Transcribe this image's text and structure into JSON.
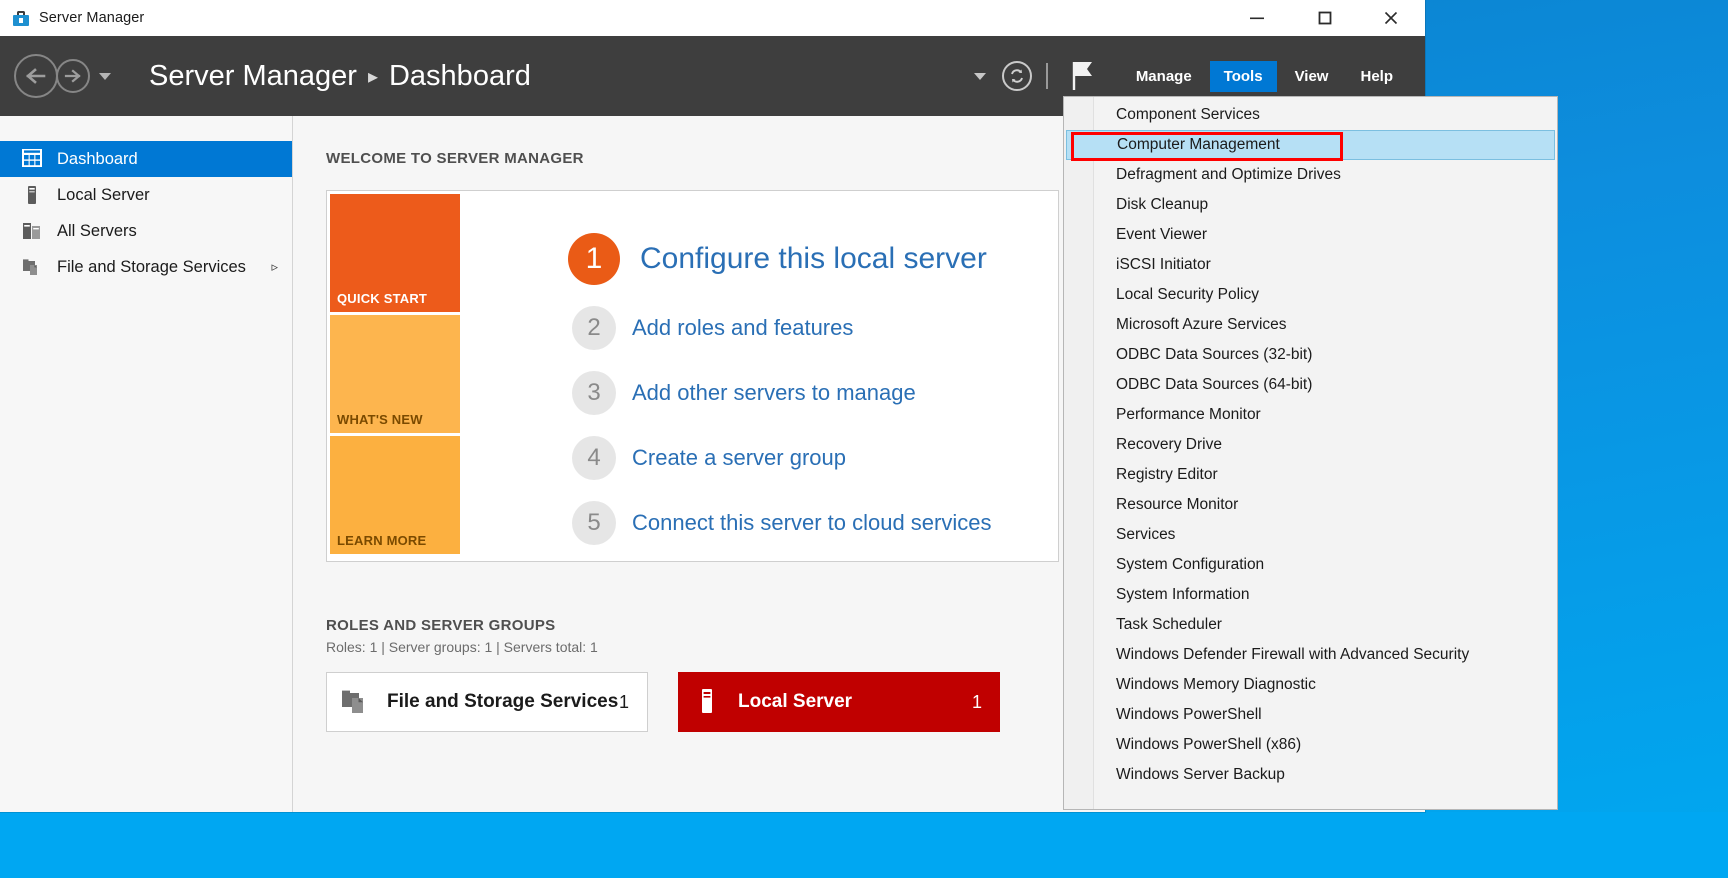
{
  "window": {
    "title": "Server Manager",
    "title_icon": "server-manager-icon",
    "controls": {
      "minimize": "minimize-icon",
      "maximize": "maximize-icon",
      "close": "close-icon"
    }
  },
  "toolbar": {
    "back_icon": "back-arrow-icon",
    "forward_icon": "forward-arrow-icon",
    "history_caret_icon": "chevron-down-icon",
    "breadcrumb": {
      "root": "Server Manager",
      "separator": "▸",
      "current": "Dashboard"
    },
    "notification_caret_icon": "chevron-down-icon",
    "refresh_icon": "refresh-icon",
    "flag_icon": "flag-icon",
    "menus": [
      {
        "label": "Manage",
        "active": false
      },
      {
        "label": "Tools",
        "active": true
      },
      {
        "label": "View",
        "active": false
      },
      {
        "label": "Help",
        "active": false
      }
    ]
  },
  "sidebar": {
    "items": [
      {
        "label": "Dashboard",
        "icon": "dashboard-grid-icon",
        "selected": true,
        "expandable": false
      },
      {
        "label": "Local Server",
        "icon": "server-icon",
        "selected": false,
        "expandable": false
      },
      {
        "label": "All Servers",
        "icon": "servers-icon",
        "selected": false,
        "expandable": false
      },
      {
        "label": "File and Storage Services",
        "icon": "file-storage-icon",
        "selected": false,
        "expandable": true,
        "chevron": "▹"
      }
    ]
  },
  "welcome": {
    "heading": "WELCOME TO SERVER MANAGER",
    "stripe": [
      {
        "label": "QUICK START",
        "color": "#ed5b1b"
      },
      {
        "label": "WHAT'S NEW",
        "color": "#fdb54e"
      },
      {
        "label": "LEARN MORE",
        "color": "#fcb040"
      }
    ],
    "steps": [
      {
        "num": "1",
        "label": "Configure this local server"
      },
      {
        "num": "2",
        "label": "Add roles and features"
      },
      {
        "num": "3",
        "label": "Add other servers to manage"
      },
      {
        "num": "4",
        "label": "Create a server group"
      },
      {
        "num": "5",
        "label": "Connect this server to cloud services"
      }
    ]
  },
  "roles": {
    "heading": "ROLES AND SERVER GROUPS",
    "summary": "Roles: 1  |  Server groups: 1  |  Servers total: 1",
    "tiles": [
      {
        "name": "File and Storage Services",
        "count": "1",
        "style": "white",
        "icon": "file-storage-icon"
      },
      {
        "name": "Local Server",
        "count": "1",
        "style": "red",
        "icon": "server-icon"
      }
    ]
  },
  "tools_menu": {
    "highlighted": "Computer Management",
    "annotation_color": "#ff0000",
    "items": [
      "Component Services",
      "Computer Management",
      "Defragment and Optimize Drives",
      "Disk Cleanup",
      "Event Viewer",
      "iSCSI Initiator",
      "Local Security Policy",
      "Microsoft Azure Services",
      "ODBC Data Sources (32-bit)",
      "ODBC Data Sources (64-bit)",
      "Performance Monitor",
      "Recovery Drive",
      "Registry Editor",
      "Resource Monitor",
      "Services",
      "System Configuration",
      "System Information",
      "Task Scheduler",
      "Windows Defender Firewall with Advanced Security",
      "Windows Memory Diagnostic",
      "Windows PowerShell",
      "Windows PowerShell (x86)",
      "Windows Server Backup"
    ]
  },
  "colors": {
    "accent": "#0078d4",
    "toolbar_bg": "#3e3e3e",
    "quick_start": "#ed5b1b",
    "alert_red": "#c00000",
    "desktop": "#00a7f2"
  }
}
